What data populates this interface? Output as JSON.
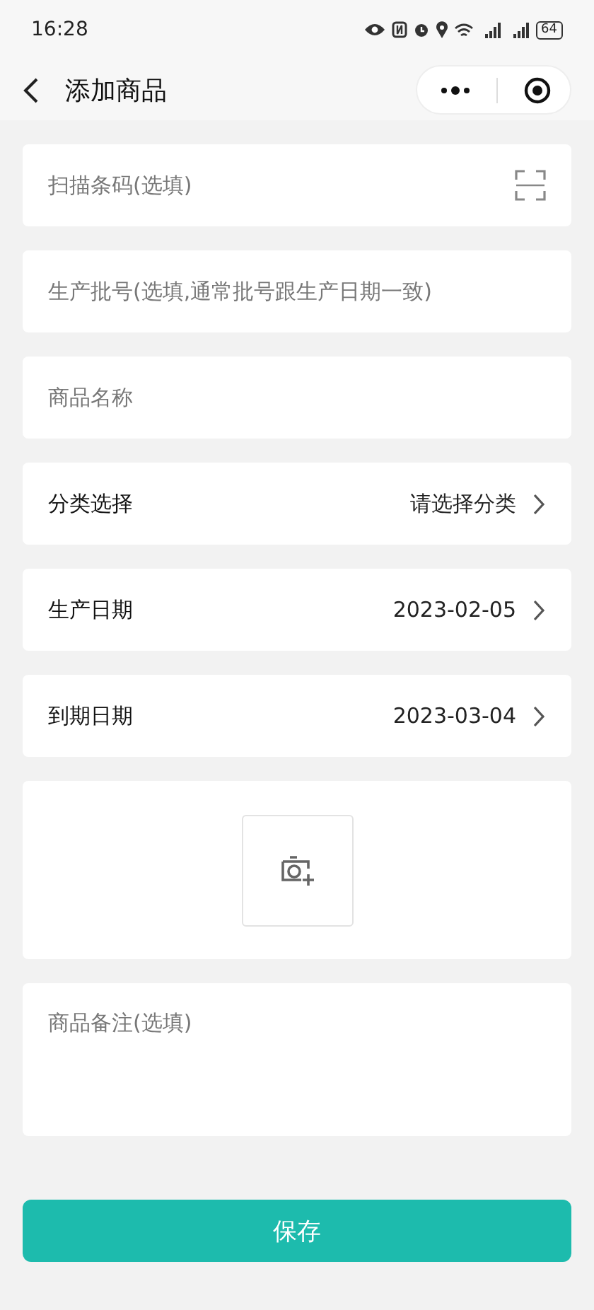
{
  "status_bar": {
    "time": "16:28",
    "battery": "64"
  },
  "nav": {
    "title": "添加商品"
  },
  "fields": [
    {
      "kind": "scan",
      "placeholder": "扫描条码(选填)"
    },
    {
      "kind": "input",
      "placeholder": "生产批号(选填,通常批号跟生产日期一致)"
    },
    {
      "kind": "input",
      "placeholder": "商品名称"
    },
    {
      "kind": "select",
      "label": "分类选择",
      "value": "请选择分类"
    },
    {
      "kind": "select",
      "label": "生产日期",
      "value": "2023-02-05"
    },
    {
      "kind": "select",
      "label": "到期日期",
      "value": "2023-03-04"
    },
    {
      "kind": "photo"
    },
    {
      "kind": "textarea",
      "placeholder": "商品备注(选填)"
    }
  ],
  "save_button": "保存"
}
